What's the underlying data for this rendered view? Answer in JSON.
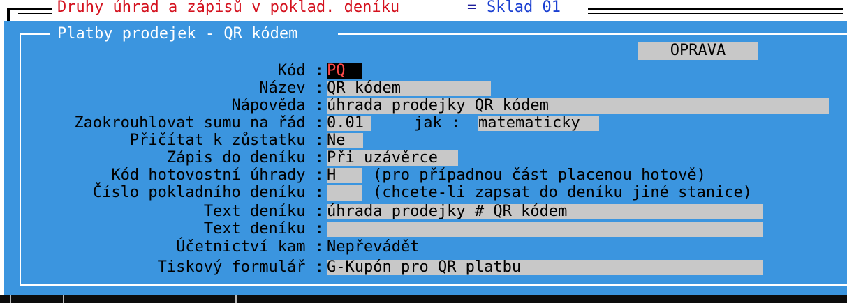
{
  "outer_window": {
    "title": "Druhy úhrad a zápisů v poklad. deníku",
    "separator": "=",
    "store": "Sklad 01"
  },
  "dialog": {
    "title": "Platby prodejek - QR kódem",
    "mode_badge": "OPRAVA"
  },
  "form": {
    "kod": {
      "label": "Kód :",
      "value": "PQ"
    },
    "nazev": {
      "label": "Název :",
      "value": "QR kódem"
    },
    "napoveda": {
      "label": "Nápověda :",
      "value": "úhrada prodejky QR kódem"
    },
    "zaokrouhlovat": {
      "label": "Zaokrouhlovat sumu na řád :",
      "value": "0.01",
      "jak_label": "jak :",
      "jak_value": "matematicky"
    },
    "pricitat": {
      "label": "Přičítat k zůstatku :",
      "value": "Ne"
    },
    "zapis": {
      "label": "Zápis do deníku :",
      "value": "Při uzávěrce"
    },
    "kod_hotovostni": {
      "label": "Kód hotovostní úhrady :",
      "value": "H",
      "hint": "(pro případnou část placenou hotově)"
    },
    "cislo_pokladniho": {
      "label": "Číslo pokladního deníku :",
      "value": "",
      "hint": "(chcete-li zapsat do deníku jiné stanice)"
    },
    "text_deniku_1": {
      "label": "Text deníku :",
      "value": "úhrada prodejky # QR kódem"
    },
    "text_deniku_2": {
      "label": "Text deníku :",
      "value": ""
    },
    "ucetnictvi": {
      "label": "Účetnictví kam :",
      "value": "Nepřevádět",
      "extra_value": ""
    },
    "tiskovy": {
      "label": "Tiskový formulář :",
      "value": "G-Kupón pro QR platbu"
    }
  },
  "colors": {
    "dialog_bg": "#3b95df",
    "field_bg": "#c8c8c8",
    "title_red": "#d4111e",
    "store_blue": "#1a3fd1",
    "active_field_bg": "#000000",
    "active_field_fg": "#ff4a4a"
  }
}
